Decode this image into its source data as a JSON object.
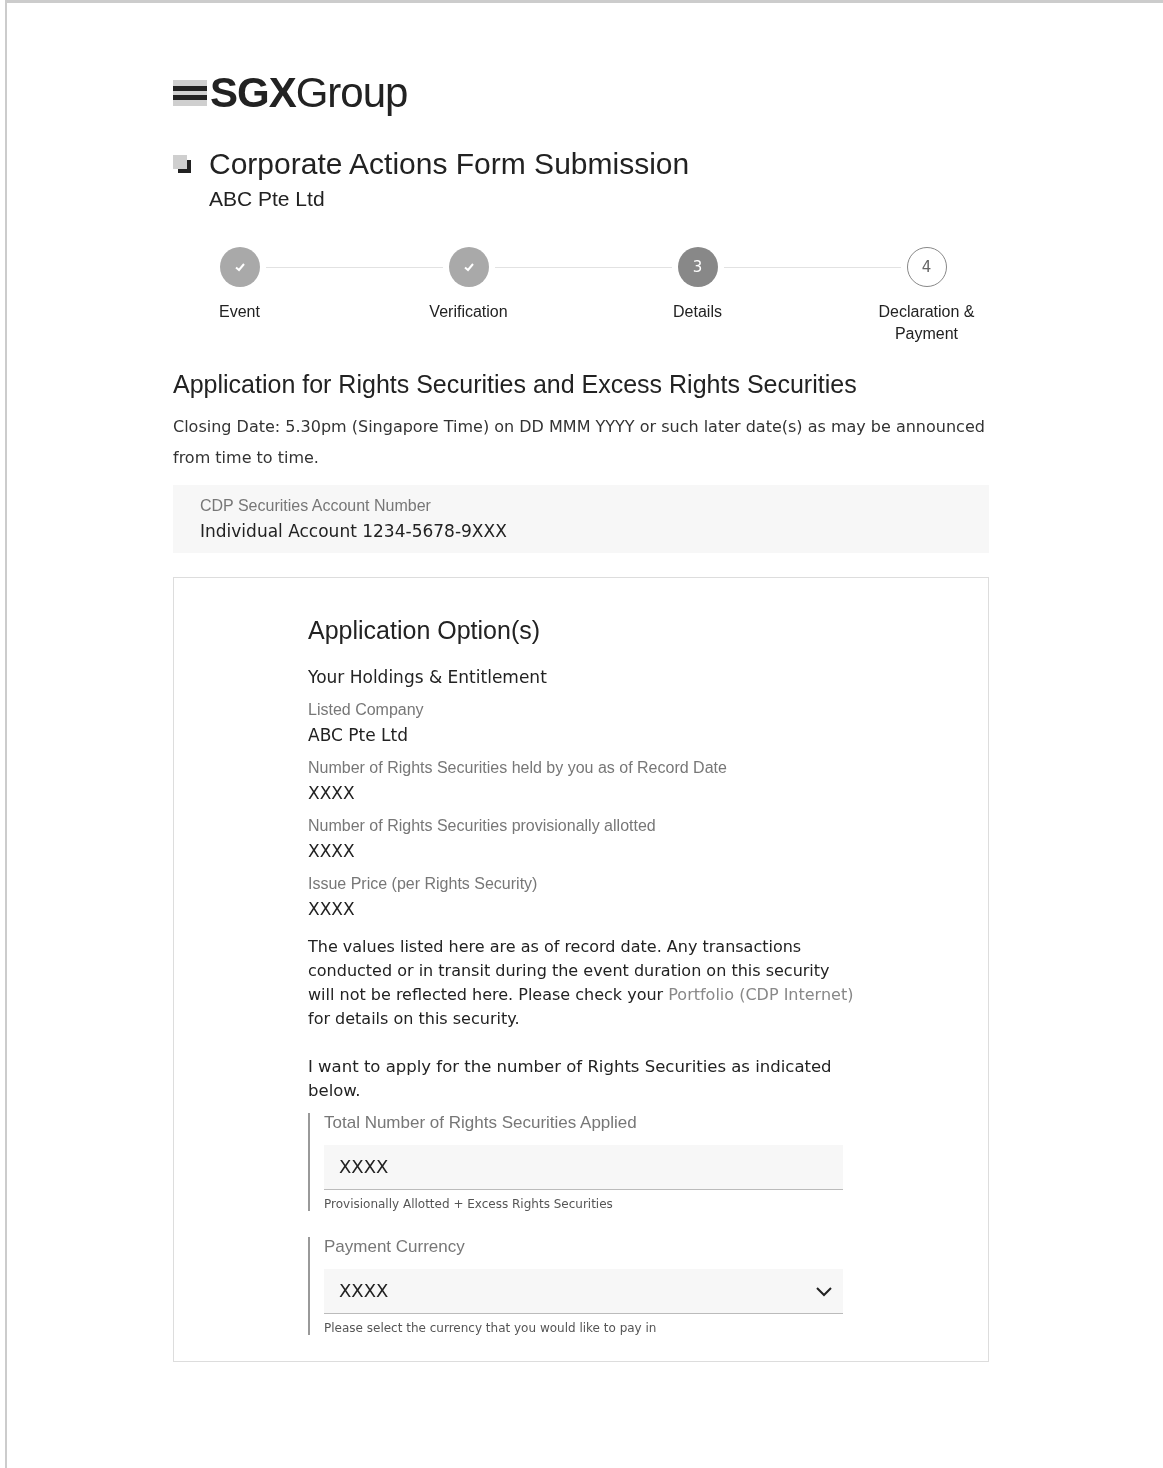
{
  "logo": {
    "bold": "SGX",
    "light": "Group"
  },
  "header": {
    "title": "Corporate Actions Form Submission",
    "company": "ABC Pte Ltd"
  },
  "steps": [
    {
      "label": "Event",
      "kind": "done"
    },
    {
      "label": "Verification",
      "kind": "done"
    },
    {
      "label": "Details",
      "kind": "current",
      "number": "3"
    },
    {
      "label": "Declaration & Payment",
      "kind": "upcoming",
      "number": "4"
    }
  ],
  "section_title": "Application for Rights Securities and Excess Rights Securities",
  "closing_date": "Closing Date: 5.30pm (Singapore Time) on DD MMM YYYY or such later date(s) as may be announced from time to time.",
  "account": {
    "label": "CDP Securities Account Number",
    "value": "Individual Account 1234-5678-9XXX"
  },
  "card": {
    "title": "Application Option(s)",
    "subtitle": "Your Holdings & Entitlement",
    "fields": [
      {
        "label": "Listed Company",
        "value": "ABC Pte Ltd"
      },
      {
        "label": "Number of Rights Securities held by you as of Record Date",
        "value": "XXXX"
      },
      {
        "label": "Number of Rights Securities provisionally allotted",
        "value": "XXXX"
      },
      {
        "label": "Issue Price (per Rights Security)",
        "value": "XXXX"
      }
    ],
    "note": {
      "before": "The values listed here are as of record date. Any transactions conducted or in transit during the event duration on this security will not be reflected here. Please check your",
      "link": "Portfolio (CDP Internet)",
      "after": "for details on this security."
    },
    "apply_text": "I want to apply for the number of Rights Securities as indicated below.",
    "inputs": [
      {
        "kind": "text",
        "label": "Total Number of Rights Securities Applied",
        "value": "XXXX",
        "hint": "Provisionally Allotted + Excess Rights Securities"
      },
      {
        "kind": "select",
        "label": "Payment Currency",
        "value": "XXXX",
        "hint": "Please select the currency that you would like to pay in"
      }
    ]
  }
}
